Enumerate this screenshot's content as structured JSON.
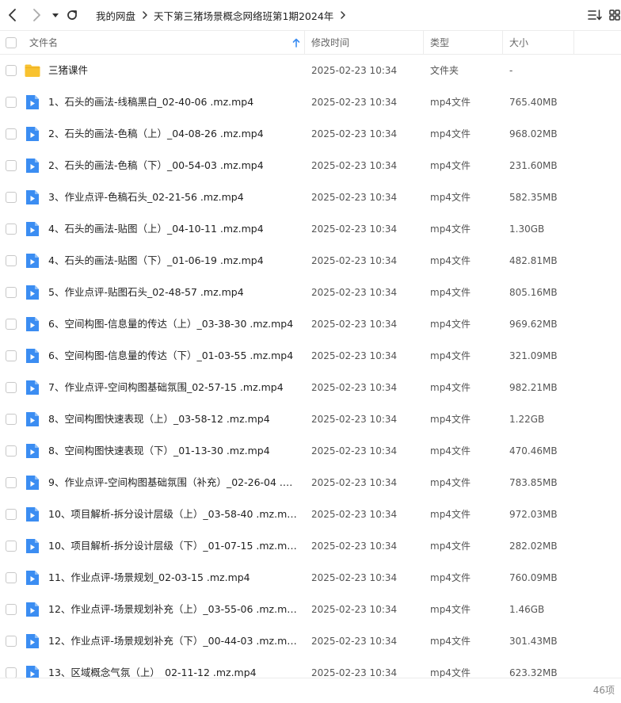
{
  "toolbar": {
    "back_icon": "chevron-left-icon",
    "forward_icon": "chevron-right-icon",
    "dropdown_icon": "caret-down-icon",
    "refresh_icon": "refresh-icon",
    "breadcrumb": [
      "我的网盘",
      "天下第三猪场景概念网络班第1期2024年"
    ],
    "sort_icon": "sort-list-icon",
    "grid_icon": "grid-view-icon"
  },
  "columns": {
    "name": "文件名",
    "modified": "修改时间",
    "type": "类型",
    "size": "大小",
    "sort_arrow_icon": "arrow-up-icon"
  },
  "colors": {
    "folder": "#f8c230",
    "video": "#3b8df2",
    "border": "#ececec"
  },
  "files": [
    {
      "name": "三猪课件",
      "time": "2025-02-23 10:34",
      "type": "文件夹",
      "size": "-",
      "kind": "folder"
    },
    {
      "name": "1、石头的画法-线稿黑白_02-40-06 .mz.mp4",
      "time": "2025-02-23 10:34",
      "type": "mp4文件",
      "size": "765.40MB",
      "kind": "video"
    },
    {
      "name": "2、石头的画法-色稿（上）_04-08-26 .mz.mp4",
      "time": "2025-02-23 10:34",
      "type": "mp4文件",
      "size": "968.02MB",
      "kind": "video"
    },
    {
      "name": "2、石头的画法-色稿（下）_00-54-03 .mz.mp4",
      "time": "2025-02-23 10:34",
      "type": "mp4文件",
      "size": "231.60MB",
      "kind": "video"
    },
    {
      "name": "3、作业点评-色稿石头_02-21-56 .mz.mp4",
      "time": "2025-02-23 10:34",
      "type": "mp4文件",
      "size": "582.35MB",
      "kind": "video"
    },
    {
      "name": "4、石头的画法-贴图（上）_04-10-11 .mz.mp4",
      "time": "2025-02-23 10:34",
      "type": "mp4文件",
      "size": "1.30GB",
      "kind": "video"
    },
    {
      "name": "4、石头的画法-贴图（下）_01-06-19 .mz.mp4",
      "time": "2025-02-23 10:34",
      "type": "mp4文件",
      "size": "482.81MB",
      "kind": "video"
    },
    {
      "name": "5、作业点评-贴图石头_02-48-57 .mz.mp4",
      "time": "2025-02-23 10:34",
      "type": "mp4文件",
      "size": "805.16MB",
      "kind": "video"
    },
    {
      "name": "6、空间构图-信息量的传达（上）_03-38-30 .mz.mp4",
      "time": "2025-02-23 10:34",
      "type": "mp4文件",
      "size": "969.62MB",
      "kind": "video"
    },
    {
      "name": "6、空间构图-信息量的传达（下）_01-03-55 .mz.mp4",
      "time": "2025-02-23 10:34",
      "type": "mp4文件",
      "size": "321.09MB",
      "kind": "video"
    },
    {
      "name": "7、作业点评-空间构图基础氛围_02-57-15 .mz.mp4",
      "time": "2025-02-23 10:34",
      "type": "mp4文件",
      "size": "982.21MB",
      "kind": "video"
    },
    {
      "name": "8、空间构图快速表现（上）_03-58-12 .mz.mp4",
      "time": "2025-02-23 10:34",
      "type": "mp4文件",
      "size": "1.22GB",
      "kind": "video"
    },
    {
      "name": "8、空间构图快速表现（下）_01-13-30 .mz.mp4",
      "time": "2025-02-23 10:34",
      "type": "mp4文件",
      "size": "470.46MB",
      "kind": "video"
    },
    {
      "name": "9、作业点评-空间构图基础氛围（补充）_02-26-04 .mz....",
      "time": "2025-02-23 10:34",
      "type": "mp4文件",
      "size": "783.85MB",
      "kind": "video"
    },
    {
      "name": "10、项目解析-拆分设计层级（上）_03-58-40 .mz.mp4",
      "time": "2025-02-23 10:34",
      "type": "mp4文件",
      "size": "972.03MB",
      "kind": "video"
    },
    {
      "name": "10、项目解析-拆分设计层级（下）_01-07-15 .mz.mp4",
      "time": "2025-02-23 10:34",
      "type": "mp4文件",
      "size": "282.02MB",
      "kind": "video"
    },
    {
      "name": "11、作业点评-场景规划_02-03-15 .mz.mp4",
      "time": "2025-02-23 10:34",
      "type": "mp4文件",
      "size": "760.09MB",
      "kind": "video"
    },
    {
      "name": "12、作业点评-场景规划补充（上）_03-55-06 .mz.mp4",
      "time": "2025-02-23 10:34",
      "type": "mp4文件",
      "size": "1.46GB",
      "kind": "video"
    },
    {
      "name": "12、作业点评-场景规划补充（下）_00-44-03 .mz.mp4",
      "time": "2025-02-23 10:34",
      "type": "mp4文件",
      "size": "301.43MB",
      "kind": "video"
    },
    {
      "name": "13、区域概念气氛（上）_02-11-12 .mz.mp4",
      "time": "2025-02-23 10:34",
      "type": "mp4文件",
      "size": "623.32MB",
      "kind": "video"
    }
  ],
  "footer": {
    "count": "46项"
  }
}
